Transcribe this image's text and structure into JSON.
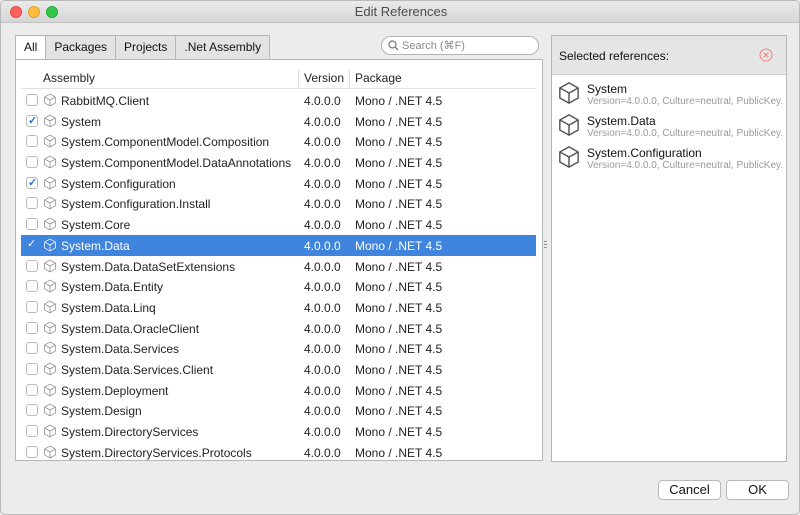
{
  "window": {
    "title": "Edit References"
  },
  "tabs": [
    {
      "label": "All",
      "active": true
    },
    {
      "label": "Packages",
      "active": false
    },
    {
      "label": "Projects",
      "active": false
    },
    {
      "label": ".Net Assembly",
      "active": false
    }
  ],
  "search": {
    "placeholder": "Search (⌘F)",
    "value": ""
  },
  "table": {
    "columns": {
      "assembly": "Assembly",
      "version": "Version",
      "package": "Package"
    },
    "rows": [
      {
        "name": "RabbitMQ.Client",
        "version": "4.0.0.0",
        "package": "Mono / .NET 4.5",
        "checked": false,
        "selected": false
      },
      {
        "name": "System",
        "version": "4.0.0.0",
        "package": "Mono / .NET 4.5",
        "checked": true,
        "selected": false
      },
      {
        "name": "System.ComponentModel.Composition",
        "version": "4.0.0.0",
        "package": "Mono / .NET 4.5",
        "checked": false,
        "selected": false
      },
      {
        "name": "System.ComponentModel.DataAnnotations",
        "version": "4.0.0.0",
        "package": "Mono / .NET 4.5",
        "checked": false,
        "selected": false
      },
      {
        "name": "System.Configuration",
        "version": "4.0.0.0",
        "package": "Mono / .NET 4.5",
        "checked": true,
        "selected": false
      },
      {
        "name": "System.Configuration.Install",
        "version": "4.0.0.0",
        "package": "Mono / .NET 4.5",
        "checked": false,
        "selected": false
      },
      {
        "name": "System.Core",
        "version": "4.0.0.0",
        "package": "Mono / .NET 4.5",
        "checked": false,
        "selected": false
      },
      {
        "name": "System.Data",
        "version": "4.0.0.0",
        "package": "Mono / .NET 4.5",
        "checked": true,
        "selected": true
      },
      {
        "name": "System.Data.DataSetExtensions",
        "version": "4.0.0.0",
        "package": "Mono / .NET 4.5",
        "checked": false,
        "selected": false
      },
      {
        "name": "System.Data.Entity",
        "version": "4.0.0.0",
        "package": "Mono / .NET 4.5",
        "checked": false,
        "selected": false
      },
      {
        "name": "System.Data.Linq",
        "version": "4.0.0.0",
        "package": "Mono / .NET 4.5",
        "checked": false,
        "selected": false
      },
      {
        "name": "System.Data.OracleClient",
        "version": "4.0.0.0",
        "package": "Mono / .NET 4.5",
        "checked": false,
        "selected": false
      },
      {
        "name": "System.Data.Services",
        "version": "4.0.0.0",
        "package": "Mono / .NET 4.5",
        "checked": false,
        "selected": false
      },
      {
        "name": "System.Data.Services.Client",
        "version": "4.0.0.0",
        "package": "Mono / .NET 4.5",
        "checked": false,
        "selected": false
      },
      {
        "name": "System.Deployment",
        "version": "4.0.0.0",
        "package": "Mono / .NET 4.5",
        "checked": false,
        "selected": false
      },
      {
        "name": "System.Design",
        "version": "4.0.0.0",
        "package": "Mono / .NET 4.5",
        "checked": false,
        "selected": false
      },
      {
        "name": "System.DirectoryServices",
        "version": "4.0.0.0",
        "package": "Mono / .NET 4.5",
        "checked": false,
        "selected": false
      },
      {
        "name": "System.DirectoryServices.Protocols",
        "version": "4.0.0.0",
        "package": "Mono / .NET 4.5",
        "checked": false,
        "selected": false
      }
    ]
  },
  "selected_panel": {
    "title": "Selected references:",
    "items": [
      {
        "name": "System",
        "detail": "Version=4.0.0.0, Culture=neutral, PublicKey..."
      },
      {
        "name": "System.Data",
        "detail": "Version=4.0.0.0, Culture=neutral, PublicKey..."
      },
      {
        "name": "System.Configuration",
        "detail": "Version=4.0.0.0, Culture=neutral, PublicKey..."
      }
    ]
  },
  "buttons": {
    "cancel": "Cancel",
    "ok": "OK"
  },
  "colors": {
    "selection": "#3f84dd",
    "checkmark": "#2d6fd6",
    "close": "#fc605c",
    "minimize": "#fdbc40",
    "maximize": "#34c84a",
    "clear_icon": "#f08a80"
  },
  "icons": {
    "assembly": "package-cube-icon",
    "search": "magnifier-icon",
    "clear": "circle-x-icon"
  }
}
